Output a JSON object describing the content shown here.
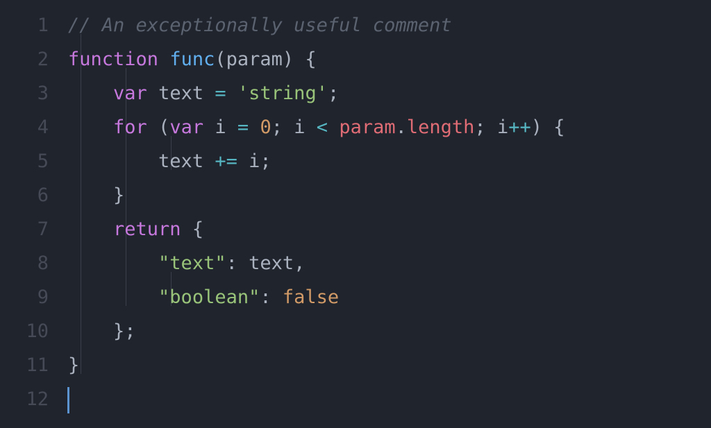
{
  "lineNumbers": [
    "1",
    "2",
    "3",
    "4",
    "5",
    "6",
    "7",
    "8",
    "9",
    "10",
    "11",
    "12"
  ],
  "code": {
    "l1": {
      "comment": "// An exceptionally useful comment"
    },
    "l2": {
      "kw": "function",
      "fn": "func",
      "paren_o": "(",
      "param": "param",
      "paren_c": ")",
      "brace": "{"
    },
    "l3": {
      "kw": "var",
      "id": "text",
      "eq": "=",
      "str": "'string'",
      "semi": ";"
    },
    "l4": {
      "for": "for",
      "po": "(",
      "var": "var",
      "i": "i",
      "eq": "=",
      "zero": "0",
      "sc1": ";",
      "i2": "i",
      "lt": "<",
      "param": "param",
      "dot": ".",
      "len": "length",
      "sc2": ";",
      "i3": "i",
      "inc": "++",
      "pc": ")",
      "brace": "{"
    },
    "l5": {
      "id": "text",
      "op": "+=",
      "i": "i",
      "semi": ";"
    },
    "l6": {
      "brace": "}"
    },
    "l7": {
      "kw": "return",
      "brace": "{"
    },
    "l8": {
      "key": "\"text\"",
      "colon": ":",
      "val": "text",
      "comma": ","
    },
    "l9": {
      "key": "\"boolean\"",
      "colon": ":",
      "val": "false"
    },
    "l10": {
      "brace": "}",
      "semi": ";"
    },
    "l11": {
      "brace": "}"
    }
  }
}
